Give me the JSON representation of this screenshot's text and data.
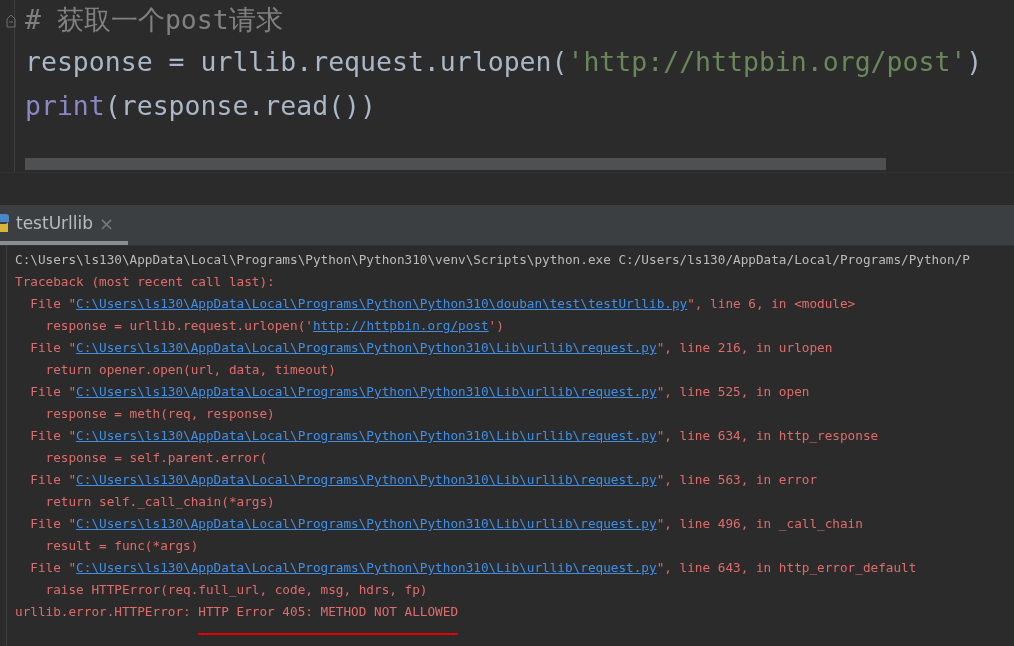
{
  "editor": {
    "lines": [
      [
        {
          "kind": "comment",
          "text": "# 获取一个post请求"
        }
      ],
      [
        {
          "kind": "plain",
          "text": "response = urllib.request.urlopen("
        },
        {
          "kind": "string",
          "text": "'http://httpbin.org/post'"
        },
        {
          "kind": "plain",
          "text": ")"
        }
      ],
      [
        {
          "kind": "builtin",
          "text": "print"
        },
        {
          "kind": "plain",
          "text": "(response.read())"
        }
      ]
    ]
  },
  "run_tab": {
    "label": "testUrllib",
    "close": "×",
    "selected": true
  },
  "console": {
    "lines": [
      {
        "kind": "info",
        "segments": [
          {
            "text": "C:\\Users\\ls130\\AppData\\Local\\Programs\\Python\\Python310\\venv\\Scripts\\python.exe C:/Users/ls130/AppData/Local/Programs/Python/P",
            "link": false
          }
        ]
      },
      {
        "kind": "error",
        "segments": [
          {
            "text": "Traceback (most recent call last):",
            "link": false
          }
        ]
      },
      {
        "kind": "error",
        "segments": [
          {
            "text": "  File \"",
            "link": false
          },
          {
            "text": "C:\\Users\\ls130\\AppData\\Local\\Programs\\Python\\Python310\\douban\\test\\testUrllib.py",
            "link": true
          },
          {
            "text": "\", line 6, in <module>",
            "link": false
          }
        ]
      },
      {
        "kind": "error",
        "segments": [
          {
            "text": "    response = urllib.request.urlopen('",
            "link": false
          },
          {
            "text": "http://httpbin.org/post",
            "link": true
          },
          {
            "text": "')",
            "link": false
          }
        ]
      },
      {
        "kind": "error",
        "segments": [
          {
            "text": "  File \"",
            "link": false
          },
          {
            "text": "C:\\Users\\ls130\\AppData\\Local\\Programs\\Python\\Python310\\Lib\\urllib\\request.py",
            "link": true
          },
          {
            "text": "\", line 216, in urlopen",
            "link": false
          }
        ]
      },
      {
        "kind": "error",
        "segments": [
          {
            "text": "    return opener.open(url, data, timeout)",
            "link": false
          }
        ]
      },
      {
        "kind": "error",
        "segments": [
          {
            "text": "  File \"",
            "link": false
          },
          {
            "text": "C:\\Users\\ls130\\AppData\\Local\\Programs\\Python\\Python310\\Lib\\urllib\\request.py",
            "link": true
          },
          {
            "text": "\", line 525, in open",
            "link": false
          }
        ]
      },
      {
        "kind": "error",
        "segments": [
          {
            "text": "    response = meth(req, response)",
            "link": false
          }
        ]
      },
      {
        "kind": "error",
        "segments": [
          {
            "text": "  File \"",
            "link": false
          },
          {
            "text": "C:\\Users\\ls130\\AppData\\Local\\Programs\\Python\\Python310\\Lib\\urllib\\request.py",
            "link": true
          },
          {
            "text": "\", line 634, in http_response",
            "link": false
          }
        ]
      },
      {
        "kind": "error",
        "segments": [
          {
            "text": "    response = self.parent.error(",
            "link": false
          }
        ]
      },
      {
        "kind": "error",
        "segments": [
          {
            "text": "  File \"",
            "link": false
          },
          {
            "text": "C:\\Users\\ls130\\AppData\\Local\\Programs\\Python\\Python310\\Lib\\urllib\\request.py",
            "link": true
          },
          {
            "text": "\", line 563, in error",
            "link": false
          }
        ]
      },
      {
        "kind": "error",
        "segments": [
          {
            "text": "    return self._call_chain(*args)",
            "link": false
          }
        ]
      },
      {
        "kind": "error",
        "segments": [
          {
            "text": "  File \"",
            "link": false
          },
          {
            "text": "C:\\Users\\ls130\\AppData\\Local\\Programs\\Python\\Python310\\Lib\\urllib\\request.py",
            "link": true
          },
          {
            "text": "\", line 496, in _call_chain",
            "link": false
          }
        ]
      },
      {
        "kind": "error",
        "segments": [
          {
            "text": "    result = func(*args)",
            "link": false
          }
        ]
      },
      {
        "kind": "error",
        "segments": [
          {
            "text": "  File \"",
            "link": false
          },
          {
            "text": "C:\\Users\\ls130\\AppData\\Local\\Programs\\Python\\Python310\\Lib\\urllib\\request.py",
            "link": true
          },
          {
            "text": "\", line 643, in http_error_default",
            "link": false
          }
        ]
      },
      {
        "kind": "error",
        "segments": [
          {
            "text": "    raise HTTPError(req.full_url, code, msg, hdrs, fp)",
            "link": false
          }
        ]
      },
      {
        "kind": "error",
        "segments": [
          {
            "text": "urllib.error.HTTPError: ",
            "link": false
          },
          {
            "text": "HTTP Error 405: METHOD NOT ALLOWED",
            "link": false,
            "annotated": true
          }
        ]
      }
    ]
  }
}
